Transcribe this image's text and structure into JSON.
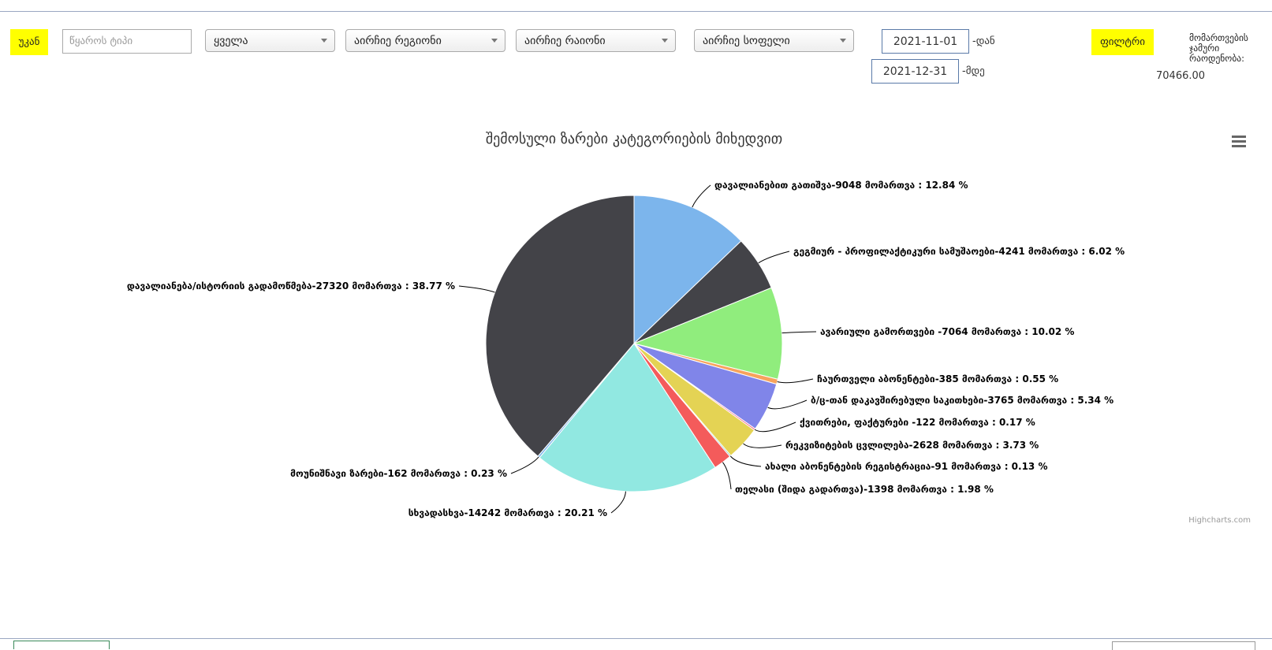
{
  "toolbar": {
    "back_label": "უკან",
    "source_placeholder": "წყაროს ტიპი",
    "select_all_label": "ყველა",
    "select_region_label": "აირჩიე რეგიონი",
    "select_district_label": "აირჩიე რაიონი",
    "select_village_label": "აირჩიე სოფელი",
    "date_from": "2021-11-01",
    "date_from_suffix": "-დან",
    "date_to": "2021-12-31",
    "date_to_suffix": "-მდე",
    "filter_label": "ფილტრი",
    "total_label": "მომართვების ჯამური რაოდენობა:",
    "total_value": "70466.00",
    "accent_color": "#ffff00"
  },
  "chart_data": {
    "type": "pie",
    "title": "შემოსული ზარები კატეგორიების მიხედვით",
    "credits": "Highcharts.com",
    "menu_icon": "hamburger-menu-icon",
    "slices": [
      {
        "label": "დავალიანებით გათიშვა-9048 მომართვა : 12.84 %",
        "value": 9048,
        "percent": 12.84,
        "color": "#7cb5ec"
      },
      {
        "label": "გეგმიურ - პროფილაქტიკური სამუშაოები-4241 მომართვა : 6.02 %",
        "value": 4241,
        "percent": 6.02,
        "color": "#434348"
      },
      {
        "label": "ავარიული გამორთვები -7064 მომართვა : 10.02 %",
        "value": 7064,
        "percent": 10.02,
        "color": "#90ed7d"
      },
      {
        "label": "ჩაურთველი აბონენტები-385 მომართვა : 0.55 %",
        "value": 385,
        "percent": 0.55,
        "color": "#f7a35c"
      },
      {
        "label": "ბ/ც-თან დაკავშირებული საკითხები-3765 მომართვა : 5.34 %",
        "value": 3765,
        "percent": 5.34,
        "color": "#8085e9"
      },
      {
        "label": "ქვითრები, ფაქტურები -122 მომართვა : 0.17 %",
        "value": 122,
        "percent": 0.17,
        "color": "#f15c80"
      },
      {
        "label": "რეკვიზიტების ცვლილება-2628 მომართვა : 3.73 %",
        "value": 2628,
        "percent": 3.73,
        "color": "#e4d354"
      },
      {
        "label": "ახალი აბონენტების რეგისტრაცია-91 მომართვა : 0.13 %",
        "value": 91,
        "percent": 0.13,
        "color": "#2b908f"
      },
      {
        "label": "თელასი (შიდა გადართვა)-1398 მომართვა : 1.98 %",
        "value": 1398,
        "percent": 1.98,
        "color": "#f45b5b"
      },
      {
        "label": "სხვადასხვა-14242 მომართვა : 20.21 %",
        "value": 14242,
        "percent": 20.21,
        "color": "#91e8e1"
      },
      {
        "label": "მოუნიშნავი ზარები-162 მომართვა : 0.23 %",
        "value": 162,
        "percent": 0.23,
        "color": "#7cb5ec"
      },
      {
        "label": "დავალიანება/ისტორიის გადამოწმება-27320 მომართვა : 38.77 %",
        "value": 27320,
        "percent": 38.77,
        "color": "#434348"
      }
    ]
  }
}
